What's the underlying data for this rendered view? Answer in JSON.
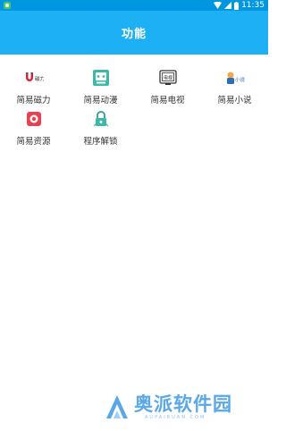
{
  "status_bar": {
    "time": "11:35",
    "notification_icon": "app-notification-icon",
    "wifi_icon": "wifi-icon",
    "signal_icon": "cell-signal-icon",
    "battery_icon": "battery-icon"
  },
  "app_bar": {
    "title": "功能",
    "background": "#1eb0f4"
  },
  "features": [
    {
      "label": "简易磁力",
      "icon": "magnet-icon"
    },
    {
      "label": "简易动漫",
      "icon": "anime-icon"
    },
    {
      "label": "简易电视",
      "icon": "tv-icon"
    },
    {
      "label": "简易小说",
      "icon": "novel-icon"
    },
    {
      "label": "简易资源",
      "icon": "resource-icon"
    },
    {
      "label": "程序解锁",
      "icon": "unlock-icon"
    }
  ],
  "watermark": {
    "text": "奥派软件园",
    "subtext": "AUPAIRUAN.COM",
    "color": "#5aa8e8"
  }
}
